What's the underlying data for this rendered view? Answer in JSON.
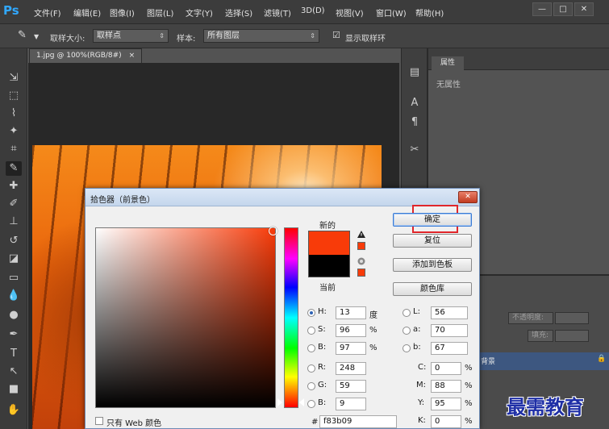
{
  "app": {
    "logo": "Ps"
  },
  "menu": {
    "items": [
      "文件(F)",
      "编辑(E)",
      "图像(I)",
      "图层(L)",
      "文字(Y)",
      "选择(S)",
      "滤镜(T)",
      "3D(D)",
      "视图(V)",
      "窗口(W)",
      "帮助(H)"
    ]
  },
  "window_controls": {
    "minimize": "—",
    "maximize": "□",
    "close": "✕"
  },
  "options_bar": {
    "sample_size_label": "取样大小:",
    "sample_size_value": "取样点",
    "sample_label": "样本:",
    "sample_value": "所有图层",
    "show_ring_label": "显示取样环"
  },
  "document": {
    "tab_title": "1.jpg @ 100%(RGB/8#)",
    "tab_close": "×"
  },
  "properties_panel": {
    "tab_label": "属性",
    "empty_text": "无属性"
  },
  "layers_panel": {
    "opacity_label": "不透明度:",
    "fill_label": "填充:",
    "layer_name": "背景"
  },
  "color_picker": {
    "title": "拾色器（前景色）",
    "label_new": "新的",
    "label_current": "当前",
    "buttons": {
      "ok": "确定",
      "reset": "复位",
      "add_to_swatches": "添加到色板",
      "color_libraries": "颜色库"
    },
    "only_web_colors": "只有 Web 颜色",
    "hsb": {
      "h": "13",
      "s": "96",
      "b": "97",
      "h_unit": "度",
      "s_unit": "%",
      "b_unit": "%"
    },
    "rgb": {
      "r": "248",
      "g": "59",
      "b": "9"
    },
    "lab": {
      "l": "56",
      "a": "70",
      "b": "67"
    },
    "cmyk": {
      "c": "0",
      "m": "88",
      "y": "95",
      "k": "0",
      "unit": "%"
    },
    "labels": {
      "H": "H:",
      "S": "S:",
      "B": "B:",
      "R": "R:",
      "G": "G:",
      "Bb": "B:",
      "L": "L:",
      "a": "a:",
      "b": "b:",
      "C": "C:",
      "M": "M:",
      "Y": "Y:",
      "K": "K:",
      "hash": "#"
    },
    "hex": "f83b09",
    "new_color": "#f83b09",
    "current_color": "#000000"
  },
  "watermark": "最需教育"
}
